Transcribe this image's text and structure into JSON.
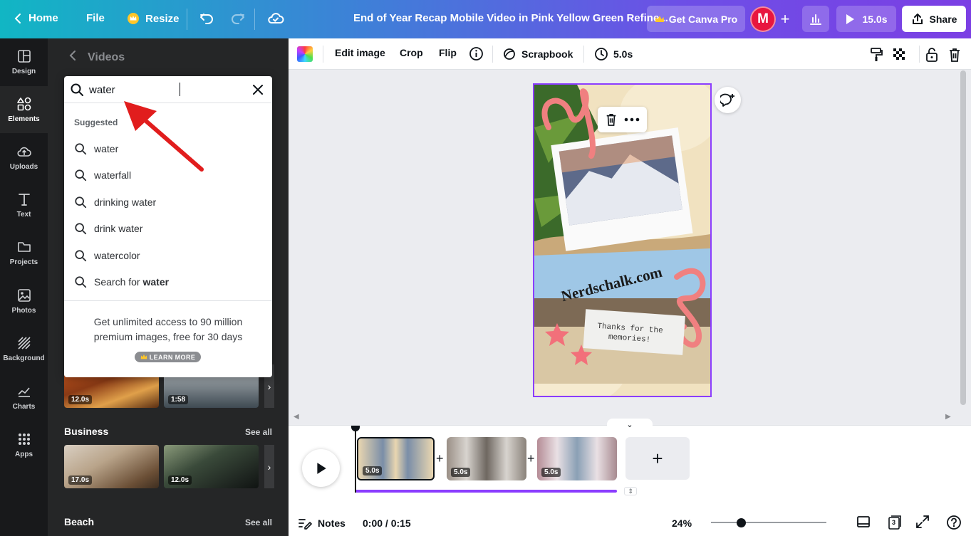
{
  "topbar": {
    "home_label": "Home",
    "file_label": "File",
    "resize_label": "Resize",
    "title": "End of Year Recap Mobile Video in Pink Yellow Green Refine...",
    "pro_label": "Get Canva Pro",
    "avatar_initial": "M",
    "play_label": "15.0s",
    "share_label": "Share"
  },
  "rail": {
    "items": [
      {
        "label": "Design",
        "icon": "layout-icon"
      },
      {
        "label": "Elements",
        "icon": "shapes-icon"
      },
      {
        "label": "Uploads",
        "icon": "upload-cloud-icon"
      },
      {
        "label": "Text",
        "icon": "text-icon"
      },
      {
        "label": "Projects",
        "icon": "folder-icon"
      },
      {
        "label": "Photos",
        "icon": "image-icon"
      },
      {
        "label": "Background",
        "icon": "hatch-icon"
      },
      {
        "label": "Charts",
        "icon": "line-chart-icon"
      },
      {
        "label": "Apps",
        "icon": "apps-grid-icon"
      }
    ],
    "active": "Elements"
  },
  "panel": {
    "back_title": "Videos",
    "categories": [
      {
        "title": "Business",
        "see_all": "See all",
        "durations": [
          "17.0s",
          "12.0s"
        ]
      },
      {
        "title": "Beach",
        "see_all": "See all"
      }
    ],
    "top_row_durations": [
      "12.0s",
      "1:58"
    ]
  },
  "search": {
    "value": "water",
    "suggested_label": "Suggested",
    "suggestions": [
      "water",
      "waterfall",
      "drinking water",
      "drink water",
      "watercolor"
    ],
    "search_for_prefix": "Search for ",
    "search_for_term": "water",
    "promo_text": "Get unlimited access to 90 million premium images, free for 30 days",
    "promo_button": "LEARN MORE"
  },
  "toolbar": {
    "edit_image": "Edit image",
    "crop": "Crop",
    "flip": "Flip",
    "scrapbook": "Scrapbook",
    "duration": "5.0s"
  },
  "design": {
    "watermark": "Nerdschalk.com",
    "note_text": "Thanks for the memories!"
  },
  "timeline": {
    "clips": [
      "5.0s",
      "5.0s",
      "5.0s"
    ]
  },
  "bottombar": {
    "notes_label": "Notes",
    "time": "0:00 / 0:15",
    "zoom": "24%",
    "page_count": "3"
  },
  "colors": {
    "accent": "#8b3dff",
    "avatar": "#e8163f",
    "rail_bg": "#18191b",
    "panel_bg": "#252627",
    "annotation_arrow": "#e11d1d"
  }
}
